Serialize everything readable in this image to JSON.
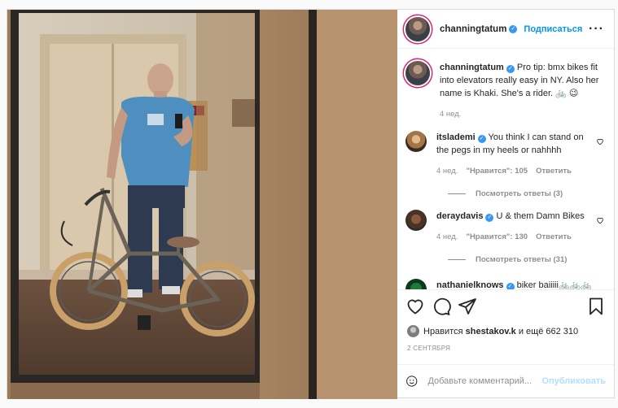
{
  "post": {
    "author": "channingtatum",
    "follow_label": "Подписаться",
    "more_icon": "more-horizontal-icon"
  },
  "caption": {
    "user": "channingtatum",
    "text": "Pro tip: bmx bikes fit into elevators really easy in NY. Also her name is Khaki. She's a rider. 🚲 😉",
    "time": "4 нед."
  },
  "comments": [
    {
      "user": "itslademi",
      "text": "You think I can stand on the pegs in my heels or nahhhh",
      "time": "4 нед.",
      "likes": "\"Нравится\": 105",
      "reply_label": "Ответить",
      "view_replies": "Посмотреть ответы (3)"
    },
    {
      "user": "deraydavis",
      "text": "U & them Damn Bikes",
      "time": "4 нед.",
      "likes": "\"Нравится\": 130",
      "reply_label": "Ответить",
      "view_replies": "Посмотреть ответы (31)"
    },
    {
      "user": "nathanielknows",
      "text": "biker baiiiii🚲🚲🚲🚲"
    }
  ],
  "actions": {
    "like_icon": "heart-icon",
    "comment_icon": "comment-icon",
    "share_icon": "paper-plane-icon",
    "save_icon": "bookmark-icon"
  },
  "likes": {
    "prefix": "Нравится",
    "user": "shestakov.k",
    "suffix": "и ещё 662 310"
  },
  "date": "2 СЕНТЯБРЯ",
  "add_comment": {
    "placeholder": "Добавьте комментарий...",
    "publish_label": "Опубликовать"
  },
  "colors": {
    "accent": "#0095f6",
    "verified": "#3897f0",
    "muted": "#8e8e8e",
    "publish_disabled": "#b2dffc"
  }
}
